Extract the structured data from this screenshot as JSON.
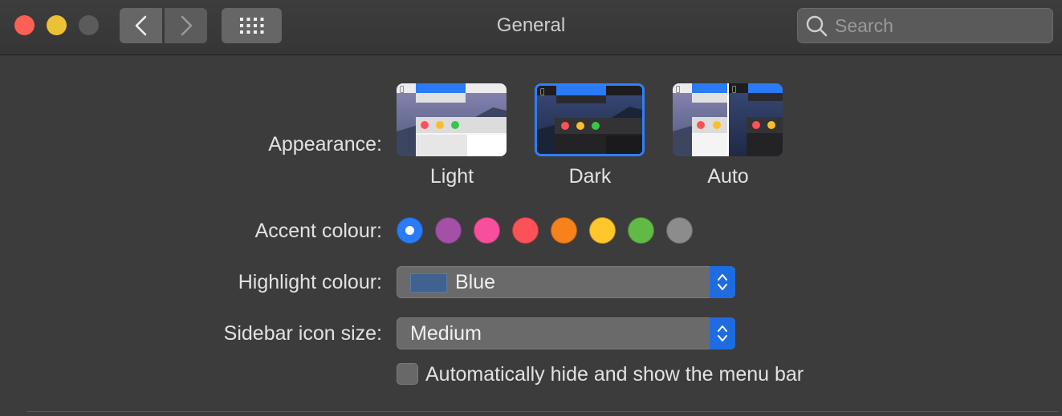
{
  "window": {
    "title": "General",
    "search_placeholder": "Search"
  },
  "appearance": {
    "label": "Appearance:",
    "options": [
      "Light",
      "Dark",
      "Auto"
    ],
    "selected": "Dark"
  },
  "accent": {
    "label": "Accent colour:",
    "colors": [
      "#2a7bf5",
      "#a550a7",
      "#f74f9e",
      "#fc5257",
      "#f7821b",
      "#ffc72c",
      "#62ba46",
      "#8c8c8c"
    ],
    "selected_index": 0
  },
  "highlight": {
    "label": "Highlight colour:",
    "value": "Blue",
    "swatch_color": "#3f6290"
  },
  "sidebar": {
    "label": "Sidebar icon size:",
    "value": "Medium"
  },
  "menubar": {
    "label": "Automatically hide and show the menu bar",
    "checked": false
  },
  "icons": {
    "back": "chevron-left-icon",
    "forward": "chevron-right-icon",
    "grid": "grid-icon",
    "search": "search-icon",
    "stepper": "up-down-chevron-icon"
  },
  "colors": {
    "accent_blue": "#2f7fff",
    "background": "#3c3c3c"
  }
}
